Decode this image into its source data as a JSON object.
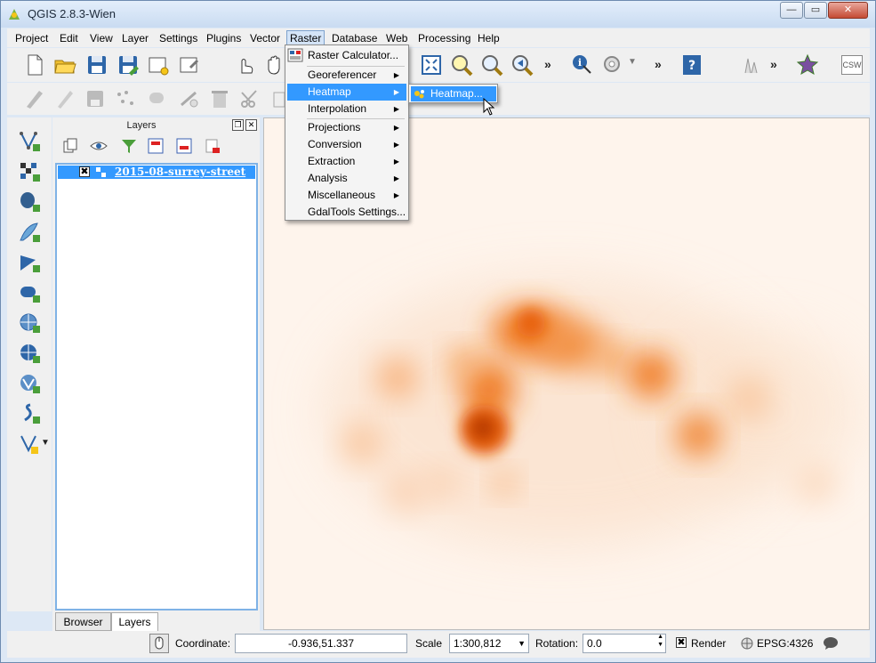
{
  "window": {
    "title": "QGIS 2.8.3-Wien",
    "controls": {
      "minimize": "—",
      "maximize": "▭",
      "close": "✕"
    }
  },
  "menubar": {
    "items": [
      {
        "label": "Project"
      },
      {
        "label": "Edit"
      },
      {
        "label": "View"
      },
      {
        "label": "Layer"
      },
      {
        "label": "Settings"
      },
      {
        "label": "Plugins"
      },
      {
        "label": "Vector"
      },
      {
        "label": "Raster"
      },
      {
        "label": "Database"
      },
      {
        "label": "Web"
      },
      {
        "label": "Processing"
      },
      {
        "label": "Help"
      }
    ],
    "active": "Raster"
  },
  "toolbar": {
    "overflow_glyph": "»",
    "csw_label": "CSW"
  },
  "raster_menu": {
    "items": [
      {
        "label": "Raster Calculator...",
        "submenu": false
      },
      {
        "label": "Georeferencer",
        "submenu": true
      },
      {
        "label": "Heatmap",
        "submenu": true,
        "highlighted": true
      },
      {
        "label": "Interpolation",
        "submenu": true
      },
      {
        "label": "Projections",
        "submenu": true
      },
      {
        "label": "Conversion",
        "submenu": true
      },
      {
        "label": "Extraction",
        "submenu": true
      },
      {
        "label": "Analysis",
        "submenu": true
      },
      {
        "label": "Miscellaneous",
        "submenu": true
      },
      {
        "label": "GdalTools Settings...",
        "submenu": false
      }
    ],
    "arrow": "▶"
  },
  "heatmap_submenu": {
    "item": "Heatmap..."
  },
  "layers_panel": {
    "title": "Layers",
    "layer": {
      "name": "2015-08-surrey-street",
      "checked": "✖"
    },
    "tabs": [
      {
        "label": "Browser"
      },
      {
        "label": "Layers"
      }
    ],
    "selected_tab": "Layers"
  },
  "statusbar": {
    "coordinate_label": "Coordinate:",
    "coordinate_value": "-0.936,51.337",
    "scale_label": "Scale",
    "scale_value": "1:300,812",
    "rotation_label": "Rotation:",
    "rotation_value": "0.0",
    "render_label": "Render",
    "render_checked": "✖",
    "crs": "EPSG:4326"
  },
  "colors": {
    "heat_core": "#b83b00",
    "heat_mid": "#f07a20",
    "heat_low": "#f9c8a0",
    "canvas_bg": "#fef4ec",
    "selection": "#3399ff"
  }
}
